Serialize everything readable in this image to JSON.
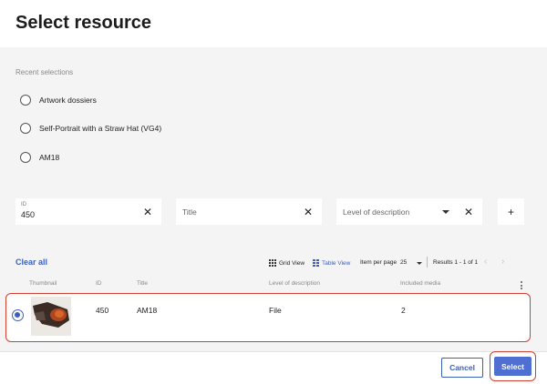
{
  "dialog": {
    "title": "Select resource"
  },
  "recent": {
    "label": "Recent selections",
    "items": [
      {
        "label": "Artwork dossiers"
      },
      {
        "label": "Self-Portrait with a Straw Hat (VG4)"
      },
      {
        "label": "AM18"
      }
    ]
  },
  "filters": {
    "id": {
      "label": "ID",
      "value": "450"
    },
    "title": {
      "placeholder": "Title"
    },
    "level": {
      "placeholder": "Level of description"
    },
    "clear_glyph": "✕",
    "add_glyph": "+"
  },
  "toolbar": {
    "clear_all": "Clear all",
    "grid_view": "Grid View",
    "table_view": "Table View",
    "per_page_label": "Item per page",
    "per_page_value": "25",
    "results": "Results 1 - 1 of 1",
    "prev_glyph": "‹",
    "next_glyph": "›"
  },
  "table": {
    "columns": [
      "Thumbnail",
      "ID",
      "Title",
      "Level of description",
      "Included media"
    ],
    "rows": [
      {
        "id": "450",
        "title": "AM18",
        "level": "File",
        "media": "2",
        "selected": true
      }
    ]
  },
  "footer": {
    "cancel_label": "Cancel",
    "select_label": "Select"
  },
  "colors": {
    "accent": "#3b5fbd",
    "select_bg": "#4f6fd1",
    "highlight": "#d43f2f",
    "panel_bg": "#f4f4f4"
  }
}
